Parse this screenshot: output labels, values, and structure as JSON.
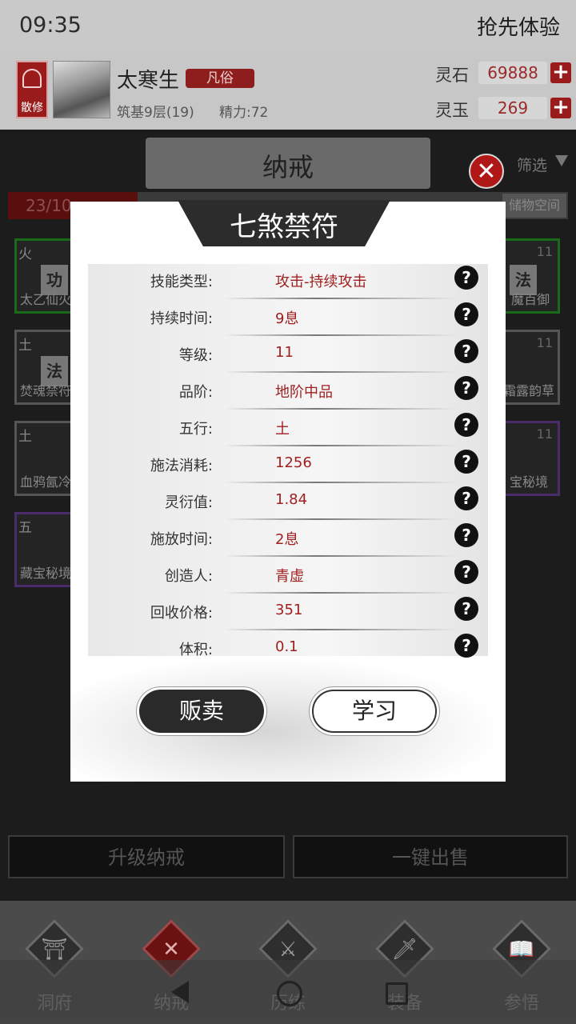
{
  "status_bar": {
    "time": "09:35"
  },
  "header": {
    "early_access": "抢先体验",
    "sect_badge": "散修",
    "player_name": "太寒生",
    "rank": "凡俗",
    "cultivation": "筑基9层(19)",
    "stamina": "精力:72",
    "currency": [
      {
        "label": "灵石",
        "value": "69888"
      },
      {
        "label": "灵玉",
        "value": "269"
      }
    ]
  },
  "inventory": {
    "title": "纳戒",
    "filter_label": "筛选",
    "storage_count": "23/10",
    "storage_label": "储物空间",
    "left_items": [
      {
        "element": "火",
        "tag": "功",
        "name": "太乙仙火"
      },
      {
        "element": "土",
        "tag": "法",
        "name": "焚魂禁符"
      },
      {
        "element": "土",
        "tag": "",
        "name": "血鸦氤冷"
      },
      {
        "element": "五",
        "tag": "",
        "name": "藏宝秘境"
      }
    ],
    "right_items": [
      {
        "level": "11",
        "tag": "法",
        "name": "魔百御"
      },
      {
        "level": "11",
        "tag": "",
        "name": "霜露韵草"
      },
      {
        "level": "11",
        "tag": "",
        "name": "宝秘境"
      }
    ],
    "upgrade_button": "升级纳戒",
    "sell_all_button": "一键出售"
  },
  "bottom_nav": [
    {
      "label": "洞府",
      "icon": "gate-icon",
      "active": false
    },
    {
      "label": "纳戒",
      "icon": "close-x-icon",
      "active": true
    },
    {
      "label": "历练",
      "icon": "swords-icon",
      "active": false
    },
    {
      "label": "装备",
      "icon": "sword-icon",
      "active": false
    },
    {
      "label": "参悟",
      "icon": "book-icon",
      "active": false
    }
  ],
  "modal": {
    "title": "七煞禁符",
    "help_glyph": "?",
    "close_glyph": "✕",
    "stats": [
      {
        "label": "技能类型:",
        "value": "攻击-持续攻击"
      },
      {
        "label": "持续时间:",
        "value": "9息"
      },
      {
        "label": "等级:",
        "value": "11"
      },
      {
        "label": "品阶:",
        "value": "地阶中品"
      },
      {
        "label": "五行:",
        "value": "土"
      },
      {
        "label": "施法消耗:",
        "value": "1256"
      },
      {
        "label": "灵衍值:",
        "value": "1.84"
      },
      {
        "label": "施放时间:",
        "value": "2息"
      },
      {
        "label": "创造人:",
        "value": "青虚"
      },
      {
        "label": "回收价格:",
        "value": "351"
      },
      {
        "label": "体积:",
        "value": "0.1"
      }
    ],
    "sell_button": "贩卖",
    "learn_button": "学习"
  },
  "colors": {
    "accent_red": "#9a1b1b",
    "value_red": "#a02020",
    "dark": "#2a2a2a"
  }
}
